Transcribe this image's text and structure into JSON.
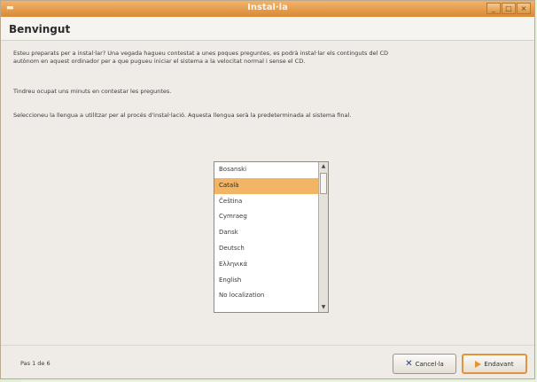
{
  "window": {
    "title": "Instal·la",
    "controls": [
      "minimize",
      "maximize",
      "close"
    ]
  },
  "page": {
    "title": "Benvingut",
    "paragraphs": [
      "Esteu preparats per a instal·lar? Una vegada hagueu contestat a unes poques preguntes, es podrà instal·lar els continguts del CD autònom en aquest ordinador per a que pugueu iniciar el sistema a la velocitat normal i sense el CD.",
      "Tindreu ocupat uns minuts en contestar les preguntes.",
      "Seleccioneu la llengua a utilitzar per al procés d'instal·lació. Aquesta llengua serà la predeterminada al sistema final."
    ]
  },
  "languages": {
    "items": [
      "Bosanski",
      "Català",
      "Čeština",
      "Cymraeg",
      "Dansk",
      "Deutsch",
      "Ελληνικά",
      "English",
      "No localization"
    ],
    "selected": "Català"
  },
  "footer": {
    "step": "Pas 1 de 6",
    "cancel_label": "Cancel·la",
    "forward_label": "Endavant"
  },
  "colors": {
    "titlebar": "#e39a47",
    "selection": "#f2b565",
    "window_bg": "#efebe7"
  },
  "icons": {
    "cancel": "close-icon",
    "forward": "forward-arrow-icon"
  }
}
